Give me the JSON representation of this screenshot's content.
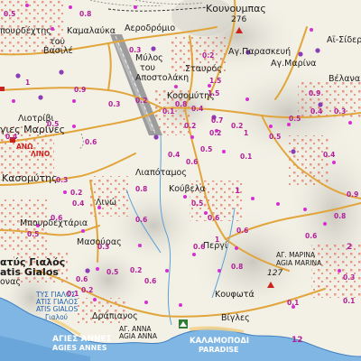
{
  "labels": {
    "kounoumpas": "Κουνουμπας",
    "kounoumpas_elev": "276",
    "poyrdechtis": "πουρδέχτης",
    "kamalauka": "Καμαλαύκα",
    "aerodromio": "Αεροδρόμιο",
    "tou": "του",
    "vasile": "Βασιλέ",
    "mylos": "Μύλος",
    "tou2": "του",
    "apostolaki": "Αποστολάκη",
    "stavros": "Σταυρός",
    "ag_paraskevi": "Αγ.Παρασκευή",
    "ag_marina_n": "Αγ.Μαρίνα",
    "ai_sider": "Αϊ-Σίδερ",
    "velana": "Βέλανα",
    "kosoumitis_n": "Κοσομύτης",
    "liotrivi": "Λιοτρίβι",
    "agies_marines": "γιες Μαρίνες",
    "ano_lino": "ΑΝΩ",
    "lino": "ΛΙΝΟ",
    "kasoumitis": "Κασομύτης",
    "liapotamos": "Λιαπόταμος",
    "kouvela": "Κούβελα",
    "lino2": "Λινώ",
    "mpourdechtaria": "Μπουρδεχτάρια",
    "masouras": "Μασούρας",
    "pergi": "Περγί",
    "aliki_gialos": "ατύς Γιαλός",
    "atis_gialos": "atis Gialos",
    "aliki_gialou": "ονας",
    "ag_marina_c": "ΑΓ. ΜΑΡΙΝΑ",
    "agia_marina": "AGIA MARINA",
    "elev127": "127",
    "koufota": "Κουφωτά",
    "vigles": "Βίγλες",
    "dramianos": "Δράπιανος",
    "sea_ammos": "ΤΥΣ ΓΙΑΛΟΣ",
    "sea_ammos2": "ΑΤΙΣ ΓΙΑΛΟΣ",
    "sea_gialos": "ATIS GIALOS",
    "sea_gialou": "Γιαλού",
    "agies_annes": "ΑΓΙΕΣ ΑΝΝΕΣ",
    "agies_annes_lat": "AGIES ANNES",
    "ag_anna": "ΑΓ. ΑΝΝΑ",
    "agia_anna": "AGIA ANNA",
    "kalamopodi": "ΚΑΛΑΜΟΠΟΔΙ",
    "paradise": "PARADISE",
    "v1": "1",
    "v2": "2",
    "v12": "12"
  },
  "distances": [
    "0.5",
    "0.8",
    "0.3",
    "0.2",
    "1",
    "0.9",
    "0.3",
    "0.2",
    "0.8",
    "1.5",
    "0.1",
    "0.4",
    "0.2",
    "0.5",
    "0.4",
    "0.3",
    "0.5",
    "0.4",
    "0.6",
    "0.7",
    "0.2",
    "1",
    "0.5",
    "0.1",
    "0.4",
    "0.5",
    "0.4",
    "0.3",
    "0.2",
    "0.8",
    "0.6",
    "0.4",
    "0.6",
    "0.6",
    "0.5",
    "0.6",
    "1",
    "0.6",
    "0.3",
    "0.5",
    "0.2",
    "0.6",
    "0.6",
    "0.8",
    "0.2",
    "0.1",
    "0.5",
    "0.6",
    "0.9",
    "0.3",
    "0.1",
    "0.1",
    "0.6",
    "0.8",
    "0.2",
    "1.5",
    "0.9"
  ],
  "colors": {
    "land": "#f3f1e6",
    "relief": "#cfcdc4",
    "sea": "#7fb6e3",
    "sea_deep": "#5d9bd6",
    "road": "#e1a53b",
    "road_dark": "#c98b2a",
    "poi": "#d62fd0",
    "building": "#e47b67",
    "runway": "#9c9c9c",
    "river": "#5aa0d6"
  },
  "icons": [
    "church-icon",
    "poi-dot-icon",
    "summit-triangle-icon",
    "campsite-icon",
    "village-square-icon",
    "runway-icon"
  ]
}
